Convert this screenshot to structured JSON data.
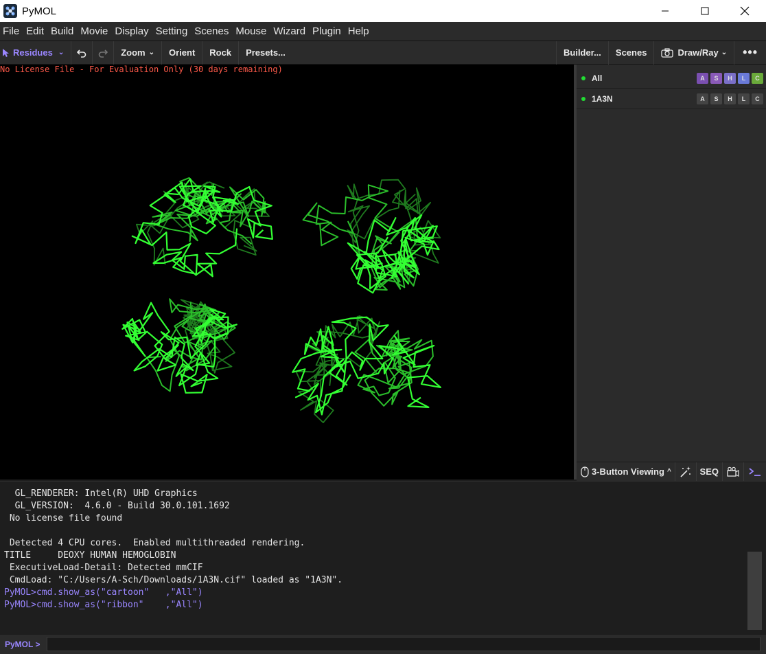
{
  "window": {
    "title": "PyMOL"
  },
  "menu": [
    "File",
    "Edit",
    "Build",
    "Movie",
    "Display",
    "Setting",
    "Scenes",
    "Mouse",
    "Wizard",
    "Plugin",
    "Help"
  ],
  "toolbar": {
    "mode_label": "Residues",
    "zoom_label": "Zoom",
    "orient_label": "Orient",
    "rock_label": "Rock",
    "presets_label": "Presets...",
    "builder_label": "Builder...",
    "scenes_label": "Scenes",
    "drawray_label": "Draw/Ray"
  },
  "viewport": {
    "license_text": "No License File - For Evaluation Only (30 days remaining)",
    "background": "#000000",
    "molecule_color": "#33ff33"
  },
  "objects": [
    {
      "name": "All",
      "buttons": [
        "A",
        "S",
        "H",
        "L",
        "C"
      ],
      "active": true
    },
    {
      "name": "1A3N",
      "buttons": [
        "A",
        "S",
        "H",
        "L",
        "C"
      ],
      "active": true
    }
  ],
  "bottom_bar": {
    "mouse_mode": "3-Button Viewing",
    "seq_label": "SEQ"
  },
  "console": {
    "lines": [
      {
        "text": "  GL_RENDERER: Intel(R) UHD Graphics",
        "type": "output"
      },
      {
        "text": "  GL_VERSION:  4.6.0 - Build 30.0.101.1692",
        "type": "output"
      },
      {
        "text": " No license file found",
        "type": "output"
      },
      {
        "text": "",
        "type": "output"
      },
      {
        "text": " Detected 4 CPU cores.  Enabled multithreaded rendering.",
        "type": "output"
      },
      {
        "text": "TITLE     DEOXY HUMAN HEMOGLOBIN",
        "type": "output"
      },
      {
        "text": " ExecutiveLoad-Detail: Detected mmCIF",
        "type": "output"
      },
      {
        "text": " CmdLoad: \"C:/Users/A-Sch/Downloads/1A3N.cif\" loaded as \"1A3N\".",
        "type": "output"
      },
      {
        "text": "PyMOL>cmd.show_as(\"cartoon\"   ,\"All\")",
        "type": "cmd"
      },
      {
        "text": "PyMOL>cmd.show_as(\"ribbon\"    ,\"All\")",
        "type": "cmd"
      }
    ],
    "prompt": "PyMOL >",
    "input_value": ""
  },
  "colors": {
    "accent_purple": "#9a86ff",
    "license_red": "#ff5a4a",
    "active_dot": "#22dd33"
  }
}
